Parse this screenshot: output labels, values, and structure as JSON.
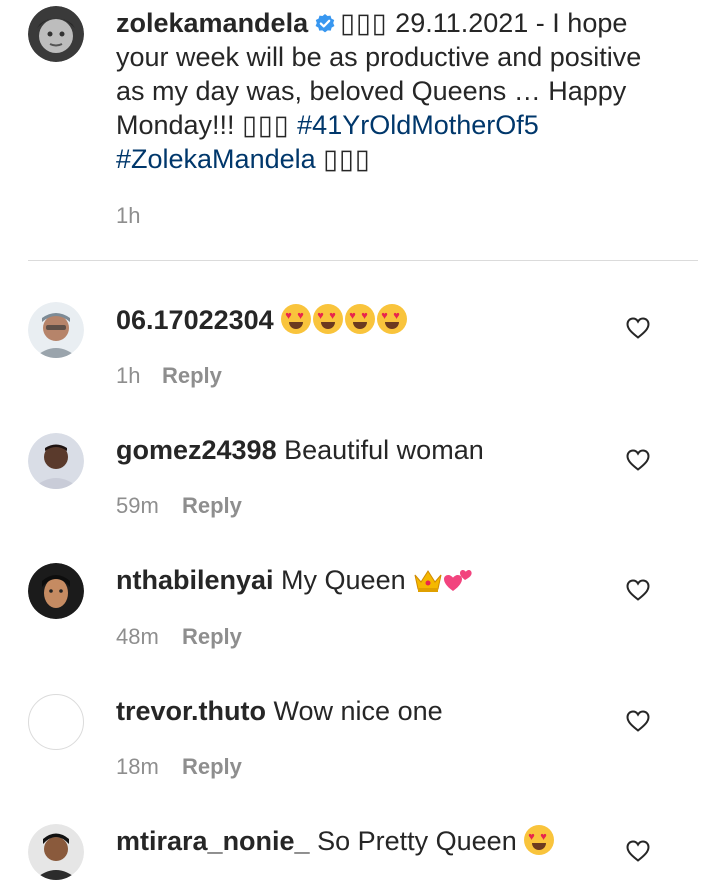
{
  "post": {
    "username": "zolekamandela",
    "glyphs_before": "▯▯▯",
    "text_1": " 29.11.2021 - I hope your week will be as productive and positive as my day was, beloved Queens … Happy Monday!!! ",
    "glyphs_mid": "▯▯▯",
    "hashtag_1": "#41YrOldMotherOf5",
    "hashtag_2": "#ZolekaMandela",
    "glyphs_end": "▯▯▯",
    "time": "1h"
  },
  "comments": [
    {
      "username": "06.17022304",
      "text": "",
      "emoji": "heart-eyes x4",
      "time": "1h",
      "reply_label": "Reply"
    },
    {
      "username": "gomez24398",
      "text": "Beautiful woman",
      "time": "59m",
      "reply_label": "Reply"
    },
    {
      "username": "nthabilenyai",
      "text": "My Queen",
      "emoji": "crown, two-hearts",
      "time": "48m",
      "reply_label": "Reply"
    },
    {
      "username": "trevor.thuto",
      "text": "Wow nice one",
      "time": "18m",
      "reply_label": "Reply"
    },
    {
      "username": "mtirara_nonie_",
      "text": "So Pretty Queen",
      "emoji": "heart-eyes"
    }
  ],
  "colors": {
    "link": "#00376b",
    "muted": "#8e8e8e",
    "text": "#262626",
    "verified": "#3897f0"
  }
}
